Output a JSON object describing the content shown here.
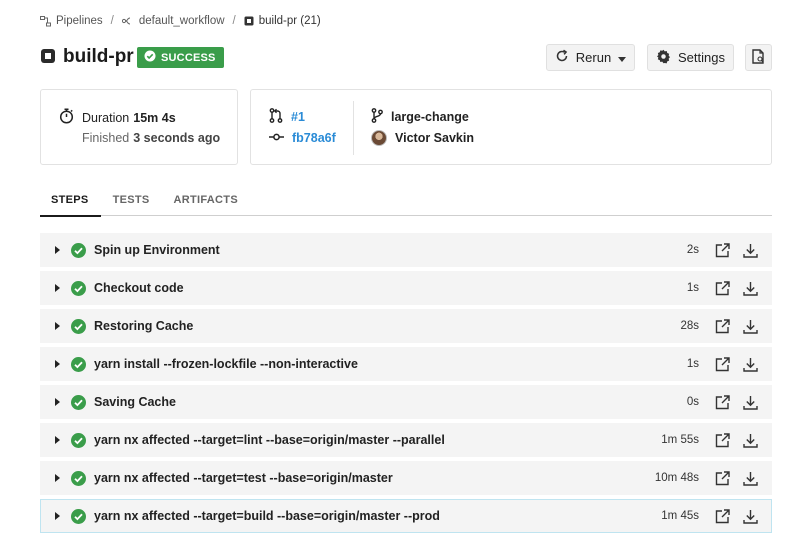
{
  "breadcrumb": {
    "items": [
      {
        "label": "Pipelines",
        "icon": "pipelines-icon"
      },
      {
        "label": "default_workflow",
        "icon": "workflow-icon"
      },
      {
        "label": "build-pr (21)",
        "icon": "job-icon"
      }
    ],
    "separator": "/"
  },
  "header": {
    "title": "build-pr",
    "status": "SUCCESS",
    "status_color": "#3a9d4a",
    "rerun_label": "Rerun",
    "settings_label": "Settings"
  },
  "summary": {
    "duration_label": "Duration",
    "duration_value": "15m 4s",
    "finished_label": "Finished",
    "finished_value": "3 seconds ago",
    "pr_number": "#1",
    "commit": "fb78a6f",
    "branch": "large-change",
    "author": "Victor Savkin",
    "link_color": "#2a8bd6"
  },
  "tabs": [
    {
      "label": "STEPS",
      "active": true
    },
    {
      "label": "TESTS",
      "active": false
    },
    {
      "label": "ARTIFACTS",
      "active": false
    }
  ],
  "steps": [
    {
      "name": "Spin up Environment",
      "duration": "2s"
    },
    {
      "name": "Checkout code",
      "duration": "1s"
    },
    {
      "name": "Restoring Cache",
      "duration": "28s"
    },
    {
      "name": "yarn install --frozen-lockfile --non-interactive",
      "duration": "1s"
    },
    {
      "name": "Saving Cache",
      "duration": "0s"
    },
    {
      "name": "yarn nx affected --target=lint --base=origin/master --parallel",
      "duration": "1m 55s"
    },
    {
      "name": "yarn nx affected --target=test --base=origin/master",
      "duration": "10m 48s"
    },
    {
      "name": "yarn nx affected --target=build --base=origin/master --prod",
      "duration": "1m 45s"
    }
  ],
  "colors": {
    "success": "#3a9d4a",
    "highlight_border": "#bfe4f0"
  }
}
